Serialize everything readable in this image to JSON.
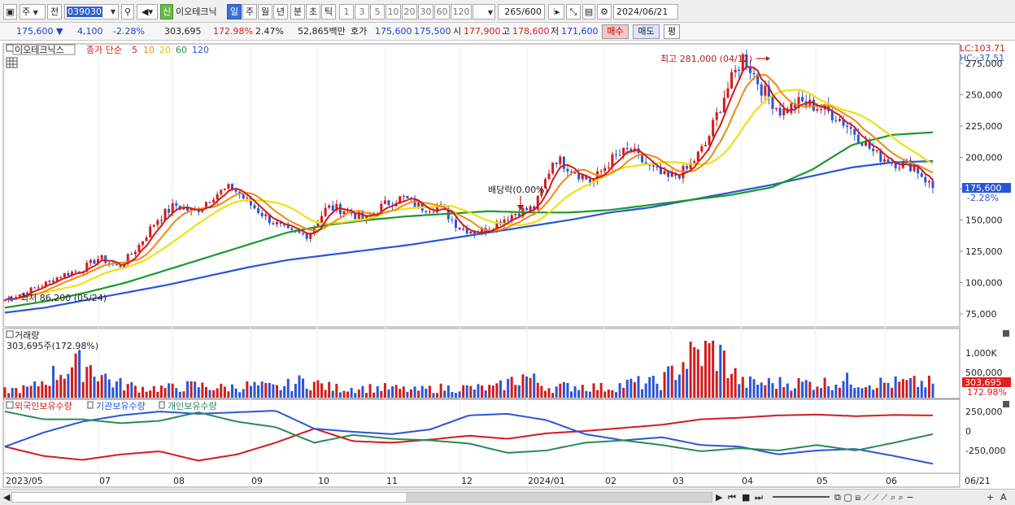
{
  "toolbar": {
    "market": "주",
    "period_btn": "전",
    "code": "039030",
    "stock_name": "이오테크닉",
    "new_badge": "신",
    "periods": [
      "일",
      "주",
      "월",
      "년",
      "분",
      "초",
      "틱"
    ],
    "minutes": [
      "1",
      "3",
      "5",
      "10",
      "20",
      "30",
      "60",
      "120"
    ],
    "count": "265",
    "count_total": "/600",
    "date": "2024/06/21"
  },
  "quote": {
    "price": "175,600",
    "change": "4,100",
    "change_rate": "-2.28%",
    "volume": "303,695",
    "vol_rate": "172.98%",
    "turnover": "2.47%",
    "amount": "52,865백만",
    "ask_label": "호가",
    "ask": "175,600",
    "bid": "175,500",
    "open_label": "시",
    "open": "177,900",
    "high_label": "고",
    "high": "178,600",
    "low_label": "저",
    "low": "171,600",
    "buy": "매수",
    "sell": "매도",
    "avg": "평"
  },
  "price_panel": {
    "name": "이오테크닉스",
    "ma_title": "종가 단순",
    "ma_periods": [
      "5",
      "10",
      "20",
      "60",
      "120"
    ],
    "ma_colors": [
      "#d41b1b",
      "#f08a10",
      "#f0e010",
      "#1a9a2a",
      "#2a55d8"
    ],
    "y_ticks": [
      "275,000",
      "250,000",
      "225,000",
      "200,000",
      "175,000",
      "150,000",
      "125,000",
      "100,000",
      "75,000"
    ],
    "lc": "LC:103.71",
    "hc": "HC:-37.51",
    "high_note": "최고 281,000 (04/12)",
    "low_note": "최저 86,200 (05/24)",
    "dividend_note": "배당락(0.00%)",
    "current_tag": "175,600",
    "current_rate": "-2.28%"
  },
  "volume_panel": {
    "title": "거래량",
    "value": "303,695주(172.98%)",
    "y_ticks": [
      "1,000K",
      "500,000"
    ],
    "current_tag": "303,695",
    "current_rate": "172.98%"
  },
  "holder_panel": {
    "series": [
      "외국인보유수량",
      "기관보유수량",
      "개인보유수량"
    ],
    "colors": [
      "#d41b1b",
      "#2a55d8",
      "#2a8a5a"
    ],
    "y_ticks": [
      "250,000",
      "0",
      "-250,000"
    ]
  },
  "x_axis": {
    "labels": [
      "2023/05",
      "07",
      "08",
      "09",
      "10",
      "11",
      "12",
      "2024/01",
      "02",
      "03",
      "04",
      "05",
      "06"
    ],
    "end_label": "06/21"
  },
  "chart_data": {
    "type": "candlestick",
    "title": "",
    "ylim": [
      70000,
      285000
    ],
    "months": [
      "2023/05",
      "07",
      "08",
      "09",
      "10",
      "11",
      "12",
      "2024/01",
      "02",
      "03",
      "04",
      "05",
      "06"
    ],
    "close_path": [
      86200,
      92000,
      98000,
      106000,
      110000,
      120000,
      112000,
      128000,
      150000,
      162000,
      156000,
      170000,
      176000,
      162000,
      150000,
      140000,
      138000,
      160000,
      158000,
      150000,
      162000,
      168000,
      160000,
      160000,
      144000,
      140000,
      148000,
      156000,
      160000,
      200000,
      190000,
      180000,
      198000,
      206000,
      192000,
      183000,
      190000,
      210000,
      250000,
      281000,
      254000,
      236000,
      244000,
      240000,
      232000,
      218000,
      202000,
      196000,
      193000,
      175600
    ],
    "ma120_path": [
      76000,
      80000,
      86000,
      92000,
      98000,
      105000,
      112000,
      118000,
      122000,
      126000,
      130000,
      135000,
      140000,
      145000,
      150000,
      156000,
      160000,
      166000,
      172000,
      178000,
      185000,
      192000,
      196000,
      197000
    ],
    "ma60_path": [
      80000,
      85000,
      92000,
      100000,
      110000,
      120000,
      130000,
      140000,
      146000,
      150000,
      153000,
      155000,
      157000,
      156000,
      156000,
      158000,
      162000,
      166000,
      170000,
      176000,
      190000,
      210000,
      218000,
      220000
    ],
    "volume_rel": [
      0.15,
      0.2,
      0.55,
      0.7,
      0.3,
      0.2,
      0.2,
      0.25,
      0.2,
      0.25,
      0.2,
      0.35,
      0.2,
      0.2,
      0.2,
      0.15,
      0.2,
      0.2,
      0.2,
      0.45,
      0.2,
      0.25,
      0.2,
      0.3,
      0.3,
      0.8,
      1.0,
      0.3,
      0.3,
      0.3,
      0.3,
      0.35,
      0.3,
      0.3,
      0.3
    ]
  }
}
